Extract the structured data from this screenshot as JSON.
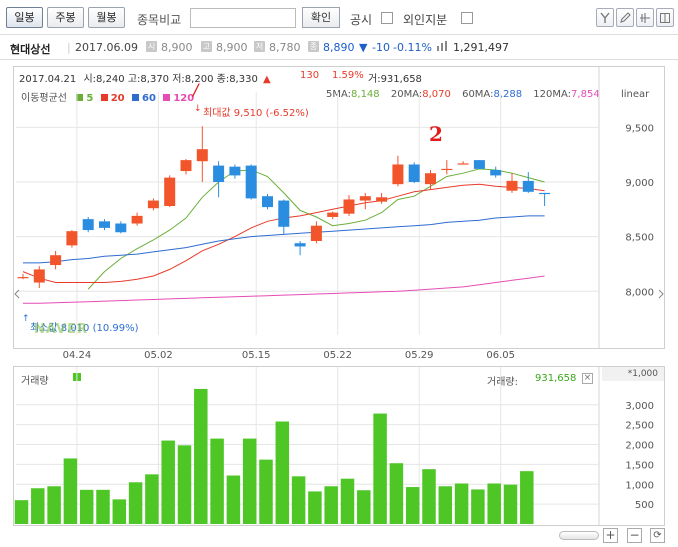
{
  "toolbar": {
    "tabs": [
      {
        "label": "일봉",
        "active": true
      },
      {
        "label": "주봉",
        "active": false
      },
      {
        "label": "월봉",
        "active": false
      }
    ],
    "compare_label": "종목비교",
    "compare_value": "",
    "confirm_label": "확인",
    "notice_label": "공시",
    "foreign_label": "외인지분",
    "icons": [
      "tools-icon",
      "pencil-icon",
      "crosshair-icon",
      "split-view-icon"
    ]
  },
  "stock": {
    "name": "현대상선",
    "date": "2017.06.09",
    "open_icon": "시",
    "open": "8,900",
    "high_icon": "고",
    "high": "8,900",
    "low_icon": "저",
    "low": "8,780",
    "close_icon": "종",
    "close": "8,890",
    "change_arrow": "▼",
    "change": "-10",
    "change_pct": "-0.11%",
    "volume_icon": "거래량-icon",
    "volume": "1,291,497"
  },
  "hover": {
    "date": "2017.04.21",
    "open": "시:8,240",
    "high": "고:8,370",
    "low": "저:8,200",
    "close": "종:8,330",
    "change": "130",
    "change_pct": "1.59%",
    "change_arrow": "▲",
    "volume": "거:931,658"
  },
  "ma_legend": {
    "title": "이동평균선",
    "items": [
      {
        "label": "5",
        "color": "#6aae38"
      },
      {
        "label": "20",
        "color": "#e83a2b"
      },
      {
        "label": "60",
        "color": "#2f6cd0"
      },
      {
        "label": "120",
        "color": "#e64db4"
      }
    ],
    "values": [
      {
        "label": "5MA:",
        "value": "8,148",
        "color": "#6aae38"
      },
      {
        "label": "20MA:",
        "value": "8,070",
        "color": "#e83a2b"
      },
      {
        "label": "60MA:",
        "value": "8,288",
        "color": "#2f6cd0"
      },
      {
        "label": "120MA:",
        "value": "7,854",
        "color": "#e64db4"
      }
    ],
    "scale_label": "linear"
  },
  "annotations": {
    "max_label": "최대값 9,510 (-6.52%)",
    "min_label": "최소값 8,010 (10.99%)",
    "mark_1": "/",
    "mark_2": "2",
    "watermark": "NAVER"
  },
  "volume_panel": {
    "title": "거래량",
    "value_label": "거래량:",
    "value": "931,658",
    "unit": "*1,000",
    "bar_color": "#4ec726"
  },
  "colors": {
    "up": "#f2542b",
    "down": "#2b8de0",
    "grid": "#e6e6e6"
  },
  "chart_data": [
    {
      "type": "candlestick",
      "title": "",
      "ylim": [
        7600,
        9750
      ],
      "yticks": [
        8000,
        8500,
        9000,
        9500
      ],
      "ytick_labels": [
        "8,000",
        "8,500",
        "9,000",
        "9,500"
      ],
      "xtick_labels": [
        {
          "index": 3,
          "label": "04.24"
        },
        {
          "index": 8,
          "label": "05.02"
        },
        {
          "index": 14,
          "label": "05.15"
        },
        {
          "index": 19,
          "label": "05.22"
        },
        {
          "index": 24,
          "label": "05.29"
        },
        {
          "index": 29,
          "label": "06.05"
        }
      ],
      "candles": [
        {
          "o": 8130,
          "h": 8160,
          "l": 8110,
          "c": 8130
        },
        {
          "o": 8080,
          "h": 8230,
          "l": 8030,
          "c": 8200
        },
        {
          "o": 8240,
          "h": 8370,
          "l": 8200,
          "c": 8330
        },
        {
          "o": 8420,
          "h": 8560,
          "l": 8400,
          "c": 8550
        },
        {
          "o": 8660,
          "h": 8680,
          "l": 8540,
          "c": 8560
        },
        {
          "o": 8640,
          "h": 8660,
          "l": 8560,
          "c": 8580
        },
        {
          "o": 8620,
          "h": 8640,
          "l": 8530,
          "c": 8540
        },
        {
          "o": 8620,
          "h": 8720,
          "l": 8600,
          "c": 8690
        },
        {
          "o": 8760,
          "h": 8850,
          "l": 8740,
          "c": 8830
        },
        {
          "o": 8780,
          "h": 9060,
          "l": 8770,
          "c": 9040
        },
        {
          "o": 9100,
          "h": 9210,
          "l": 9070,
          "c": 9200
        },
        {
          "o": 9190,
          "h": 9510,
          "l": 9000,
          "c": 9300
        },
        {
          "o": 9150,
          "h": 9190,
          "l": 8860,
          "c": 9000
        },
        {
          "o": 9140,
          "h": 9160,
          "l": 9030,
          "c": 9060
        },
        {
          "o": 9150,
          "h": 9160,
          "l": 8840,
          "c": 8850
        },
        {
          "o": 8870,
          "h": 8890,
          "l": 8750,
          "c": 8770
        },
        {
          "o": 8830,
          "h": 8840,
          "l": 8520,
          "c": 8590
        },
        {
          "o": 8440,
          "h": 8460,
          "l": 8330,
          "c": 8410
        },
        {
          "o": 8460,
          "h": 8640,
          "l": 8440,
          "c": 8600
        },
        {
          "o": 8680,
          "h": 8730,
          "l": 8660,
          "c": 8720
        },
        {
          "o": 8710,
          "h": 8880,
          "l": 8690,
          "c": 8840
        },
        {
          "o": 8830,
          "h": 8900,
          "l": 8750,
          "c": 8870
        },
        {
          "o": 8820,
          "h": 8900,
          "l": 8800,
          "c": 8860
        },
        {
          "o": 8980,
          "h": 9240,
          "l": 8960,
          "c": 9160
        },
        {
          "o": 9160,
          "h": 9180,
          "l": 8990,
          "c": 9000
        },
        {
          "o": 8980,
          "h": 9110,
          "l": 8930,
          "c": 9080
        },
        {
          "o": 9110,
          "h": 9200,
          "l": 9070,
          "c": 9120
        },
        {
          "o": 9170,
          "h": 9190,
          "l": 9160,
          "c": 9170
        },
        {
          "o": 9200,
          "h": 9200,
          "l": 9120,
          "c": 9120
        },
        {
          "o": 9110,
          "h": 9140,
          "l": 9040,
          "c": 9060
        },
        {
          "o": 8920,
          "h": 9080,
          "l": 8900,
          "c": 9010
        },
        {
          "o": 9010,
          "h": 9090,
          "l": 8900,
          "c": 8910
        },
        {
          "o": 8900,
          "h": 8900,
          "l": 8780,
          "c": 8890
        }
      ],
      "series": [
        {
          "name": "5",
          "color": "#6aae38",
          "values": [
            null,
            null,
            null,
            null,
            8020,
            8180,
            8300,
            8390,
            8470,
            8560,
            8670,
            8860,
            9000,
            9100,
            9110,
            9050,
            8900,
            8740,
            8680,
            8600,
            8620,
            8650,
            8720,
            8840,
            8870,
            8960,
            9050,
            9080,
            9120,
            9110,
            9080,
            9040,
            9000
          ]
        },
        {
          "name": "20",
          "color": "#e83a2b",
          "values": [
            8180,
            8120,
            8080,
            8080,
            8080,
            8080,
            8090,
            8110,
            8140,
            8200,
            8280,
            8370,
            8430,
            8500,
            8580,
            8640,
            8670,
            8690,
            8720,
            8750,
            8780,
            8810,
            8830,
            8870,
            8910,
            8930,
            8950,
            8970,
            8980,
            8960,
            8950,
            8940,
            8920
          ]
        },
        {
          "name": "60",
          "color": "#2f6cd0",
          "values": [
            8260,
            8260,
            8270,
            8290,
            8300,
            8320,
            8330,
            8340,
            8360,
            8380,
            8400,
            8430,
            8460,
            8480,
            8500,
            8510,
            8520,
            8530,
            8540,
            8550,
            8560,
            8570,
            8580,
            8590,
            8600,
            8610,
            8630,
            8640,
            8650,
            8670,
            8680,
            8690,
            8690
          ]
        },
        {
          "name": "120",
          "color": "#e64db4",
          "values": [
            7890,
            7890,
            7895,
            7900,
            7905,
            7910,
            7915,
            7920,
            7925,
            7930,
            7935,
            7940,
            7945,
            7950,
            7955,
            7960,
            7965,
            7970,
            7975,
            7980,
            7985,
            7990,
            7995,
            8000,
            8010,
            8020,
            8030,
            8040,
            8060,
            8080,
            8100,
            8120,
            8140
          ]
        }
      ]
    },
    {
      "type": "bar",
      "title": "",
      "ylim": [
        0,
        3700
      ],
      "yticks": [
        500,
        1000,
        1500,
        2000,
        2500,
        3000
      ],
      "ytick_labels": [
        "500",
        "1,000",
        "1,500",
        "2,000",
        "2,500",
        "3,000"
      ],
      "values": [
        600,
        900,
        950,
        1650,
        860,
        860,
        620,
        1050,
        1250,
        2100,
        1980,
        3400,
        2150,
        1220,
        2150,
        1620,
        2580,
        1200,
        820,
        950,
        1140,
        850,
        2780,
        1530,
        930,
        1380,
        950,
        1020,
        870,
        1020,
        990,
        1330
      ]
    }
  ]
}
